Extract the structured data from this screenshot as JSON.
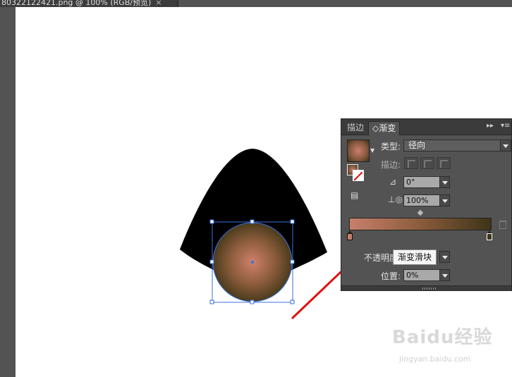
{
  "document_tab": {
    "title": "80322122421.png  @ 100% (RGB/预览)",
    "close": "×"
  },
  "panel": {
    "tabs": {
      "stroke": "描边",
      "gradient": "渐变",
      "gradient_prefix": "◇"
    },
    "header_icons": {
      "collapse": "▸▸",
      "menu": "▾≡"
    },
    "type_label": "类型:",
    "type_value": "径向",
    "stroke_label": "描边:",
    "angle_value": "0°",
    "aspect_value": "100%",
    "opacity_label": "不透明度",
    "location_label": "位置:",
    "location_value": "0%"
  },
  "tooltip": {
    "text": "渐变滑块"
  },
  "gradient": {
    "start_color": "#c97f6b",
    "end_color": "#3e3418",
    "type": "radial"
  },
  "watermark": {
    "brand": "Baidu经验",
    "url": "jingyan.baidu.com"
  },
  "colors": {
    "arrow": "#e01010",
    "selection": "#3a6fe0"
  }
}
